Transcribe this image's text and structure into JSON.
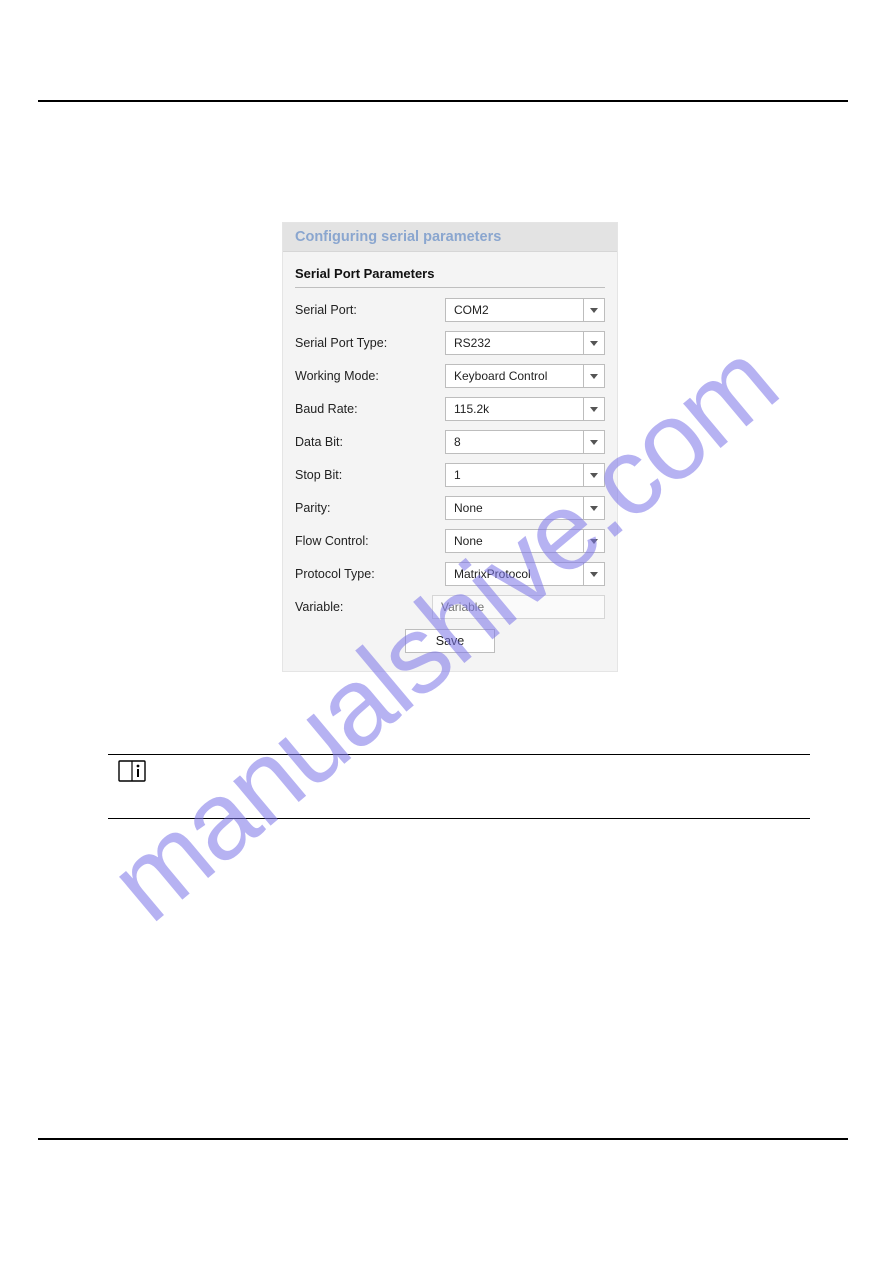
{
  "watermark": "manualshive.com",
  "panel": {
    "title": "Configuring serial parameters",
    "section_title": "Serial Port Parameters",
    "rows": {
      "serial_port": {
        "label": "Serial Port:",
        "value": "COM2"
      },
      "serial_port_type": {
        "label": "Serial Port Type:",
        "value": "RS232"
      },
      "working_mode": {
        "label": "Working Mode:",
        "value": "Keyboard Control"
      },
      "baud_rate": {
        "label": "Baud Rate:",
        "value": "115.2k"
      },
      "data_bit": {
        "label": "Data Bit:",
        "value": "8"
      },
      "stop_bit": {
        "label": "Stop Bit:",
        "value": "1"
      },
      "parity": {
        "label": "Parity:",
        "value": "None"
      },
      "flow_control": {
        "label": "Flow Control:",
        "value": "None"
      },
      "protocol_type": {
        "label": "Protocol Type:",
        "value": "MatrixProtocol"
      },
      "variable": {
        "label": "Variable:",
        "placeholder": "Variable"
      }
    },
    "save_label": "Save"
  }
}
